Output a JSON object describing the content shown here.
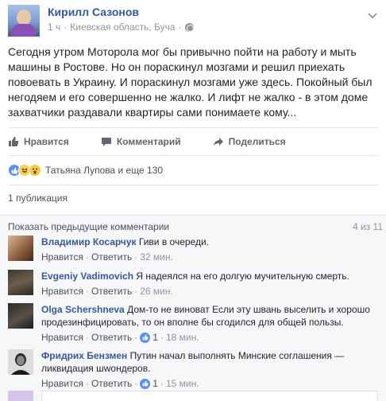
{
  "post": {
    "author": "Кирилл Сазонов",
    "time": "1 ч",
    "separator": "·",
    "location": "Киевская область, Буча",
    "text": "Сегодня утром Моторола мог бы привычно пойти на работу и мыть машины в Ростове. Но он пораскинул мозгами и решил приехать повоевать в Украину. И пораскинул мозгами уже здесь. Покойный был негодяем и его совершенно не жалко. И лифт не жалко - в этом доме захватчики раздавали квартиры сами понимаете кому..."
  },
  "actions": {
    "like": "Нравится",
    "comment": "Комментарий",
    "share": "Поделиться"
  },
  "reactions": {
    "text": "Татьяна Лупова и еще 130"
  },
  "shares": {
    "text": "1 публикация"
  },
  "comments": {
    "show_previous": "Показать предыдущие комментарии",
    "counter": "4 из 11",
    "like_label": "Нравится",
    "reply_label": "Ответить",
    "dot": "·",
    "items": [
      {
        "author": "Владимир Косарчук",
        "text": "Гиви в очереди.",
        "time": "32 мин.",
        "likes": ""
      },
      {
        "author": "Evgeniy Vadimovich",
        "text": "Я надеялся на его долгую мучительную смерть.",
        "time": "26 мин.",
        "likes": ""
      },
      {
        "author": "Olga Schershneva",
        "text": "Дом-то не виноват Если эту швань выселить и хорошо продезинфицировать, то он вполне бы сгодился для общей пользы.",
        "time": "18 мин.",
        "likes": "1"
      },
      {
        "author": "Фридрих Бензмен",
        "text": "Путин начал выполнять Минские соглашения — ликвидация шwондеров.",
        "time": "15 мин.",
        "likes": "1"
      }
    ]
  },
  "colors": {
    "link": "#365899",
    "meta": "#90949c",
    "like_blue": "#5890ff",
    "comments_bg": "#f6f7f9"
  }
}
